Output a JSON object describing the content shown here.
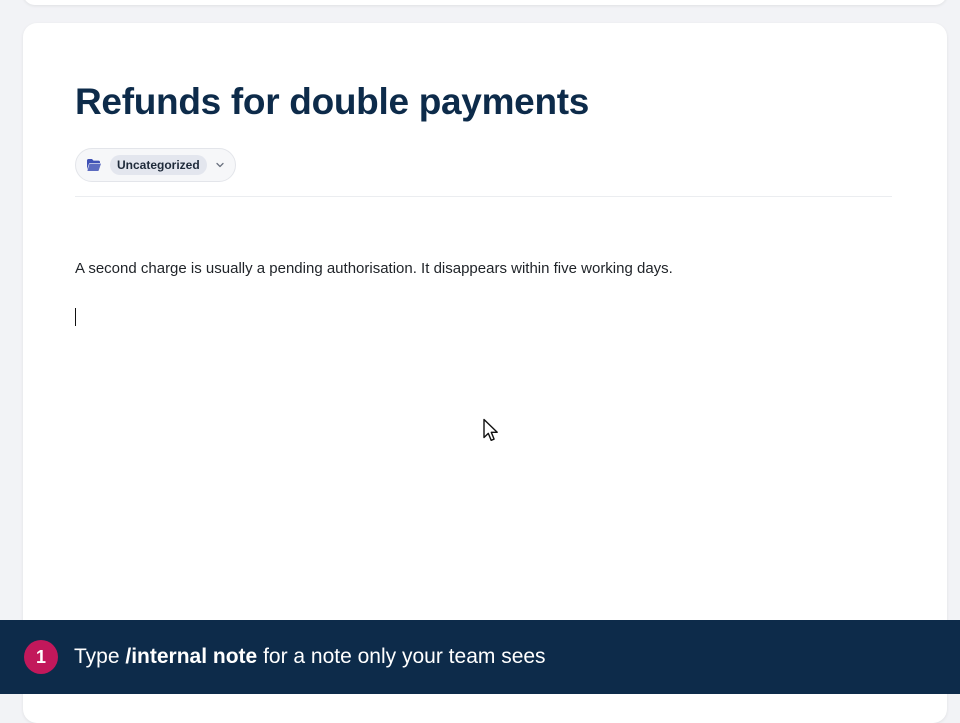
{
  "article": {
    "title": "Refunds for double payments",
    "category": "Uncategorized",
    "body": "A second charge is usually a pending authorisation. It disappears within five working days."
  },
  "hint": {
    "step": "1",
    "prefix": "Type ",
    "command": "/internal note",
    "suffix": " for a note only your team sees"
  },
  "icons": {
    "category": "folder-open-icon",
    "dropdown": "chevron-down-icon",
    "pointer": "mouse-pointer-icon"
  },
  "colors": {
    "title": "#0d2b4a",
    "hint_bar": "#0d2b4a",
    "step_badge": "#c2185b",
    "folder_icon": "#3f51b5"
  }
}
